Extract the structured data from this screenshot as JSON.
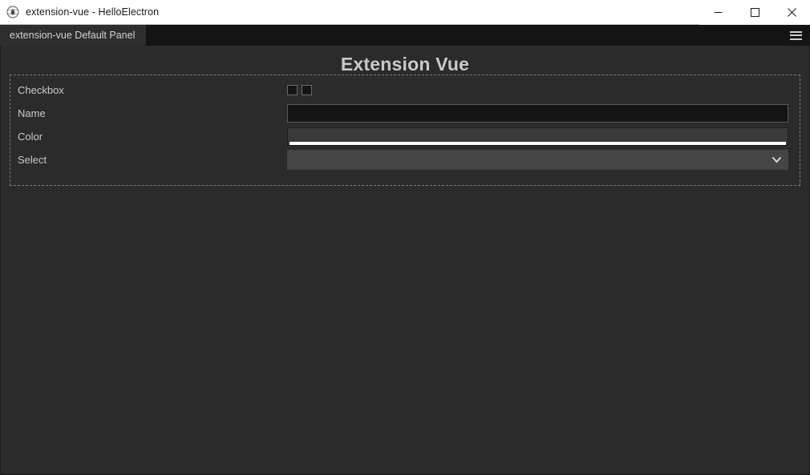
{
  "window": {
    "title": "extension-vue - HelloElectron",
    "app_icon": "electron-droplet-icon",
    "controls": {
      "minimize_label": "Minimize",
      "maximize_label": "Maximize",
      "close_label": "Close"
    }
  },
  "tabstrip": {
    "tabs": [
      {
        "label": "extension-vue Default Panel",
        "active": true
      }
    ],
    "menu_button_label": "Menu"
  },
  "page": {
    "title": "Extension Vue"
  },
  "form": {
    "rows": [
      {
        "label": "Checkbox",
        "type": "checkbox-group",
        "checkboxes": [
          {
            "name": "checkbox-1",
            "checked": false
          },
          {
            "name": "checkbox-2",
            "checked": false
          }
        ]
      },
      {
        "label": "Name",
        "type": "text",
        "value": "",
        "placeholder": ""
      },
      {
        "label": "Color",
        "type": "color",
        "value": "#ffffff"
      },
      {
        "label": "Select",
        "type": "select",
        "value": "",
        "options": [
          ""
        ]
      }
    ]
  },
  "colors": {
    "titlebar_bg": "#ffffff",
    "titlebar_text": "#1a1a1a",
    "tabstrip_bg": "#141414",
    "tab_active_bg": "#2e2e2e",
    "page_bg": "#2b2b2b",
    "heading_text": "#c9c9c9",
    "label_text": "#c9c9c9",
    "panel_border": "#7a7a7a",
    "input_bg": "#141414",
    "input_border": "#595959",
    "color_field_bg": "#3a3a3a",
    "color_swatch": "#ffffff",
    "select_bg": "#454545"
  }
}
